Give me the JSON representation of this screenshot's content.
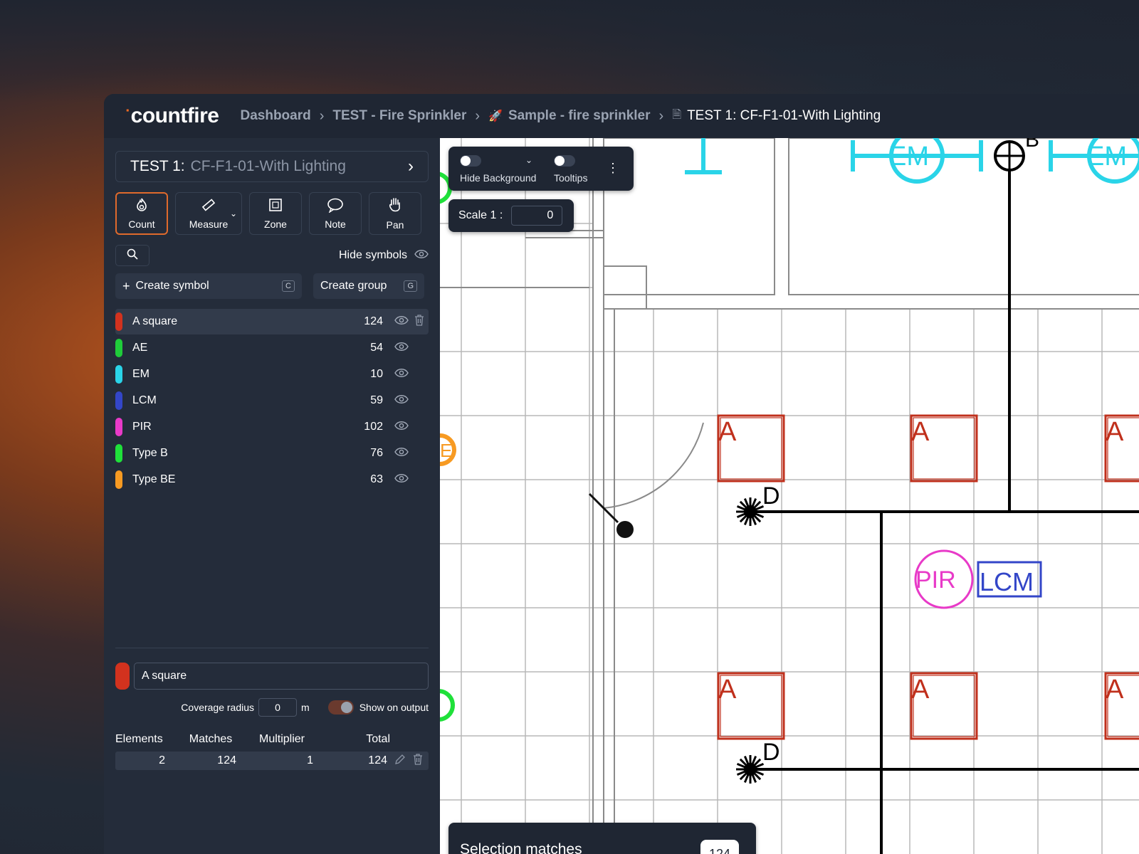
{
  "app": {
    "logo_text": "countfire"
  },
  "breadcrumbs": {
    "items": [
      "Dashboard",
      "TEST - Fire Sprinkler",
      "Sample - fire sprinkler"
    ],
    "current": "TEST 1: CF-F1-01-With Lighting"
  },
  "sidebar": {
    "title_prefix": "TEST 1:",
    "title_name": "CF-F1-01-With Lighting",
    "tools": [
      {
        "label": "Count",
        "icon": "flame-icon",
        "glyph": "🔥"
      },
      {
        "label": "Measure",
        "icon": "ruler-icon",
        "glyph": "📏"
      },
      {
        "label": "Zone",
        "icon": "zone-icon",
        "glyph": "⬚"
      },
      {
        "label": "Note",
        "icon": "speech-bubble-icon",
        "glyph": "💬"
      },
      {
        "label": "Pan",
        "icon": "hand-icon",
        "glyph": "✋"
      }
    ],
    "hide_symbols_label": "Hide symbols",
    "create_symbol_label": "Create symbol",
    "create_symbol_shortcut": "C",
    "create_group_label": "Create group",
    "create_group_shortcut": "G",
    "symbols": [
      {
        "name": "A square",
        "count": "124",
        "color": "#d2321e"
      },
      {
        "name": "AE",
        "count": "54",
        "color": "#1fcc3a"
      },
      {
        "name": "EM",
        "count": "10",
        "color": "#2ad4e8"
      },
      {
        "name": "LCM",
        "count": "59",
        "color": "#3346c8"
      },
      {
        "name": "PIR",
        "count": "102",
        "color": "#e83ac8"
      },
      {
        "name": "Type B",
        "count": "76",
        "color": "#1fe03a"
      },
      {
        "name": "Type BE",
        "count": "63",
        "color": "#f79a22"
      }
    ],
    "detail": {
      "name": "A square",
      "coverage_label": "Coverage radius",
      "coverage_value": "0",
      "coverage_unit": "m",
      "show_output_label": "Show on output"
    },
    "table": {
      "headers": [
        "Elements",
        "Matches",
        "Multiplier",
        "Total"
      ],
      "row": [
        "2",
        "124",
        "1",
        "124"
      ]
    }
  },
  "canvas": {
    "hide_background_label": "Hide Background",
    "tooltips_label": "Tooltips",
    "scale_label": "Scale 1 :",
    "scale_value": "0",
    "selection_label": "Selection matches",
    "selection_count": "124",
    "drawing_labels": {
      "a": "A",
      "em": "EM",
      "pir": "PIR",
      "lcm": "LCM",
      "d": "D",
      "b": "B",
      "e": "E"
    }
  }
}
